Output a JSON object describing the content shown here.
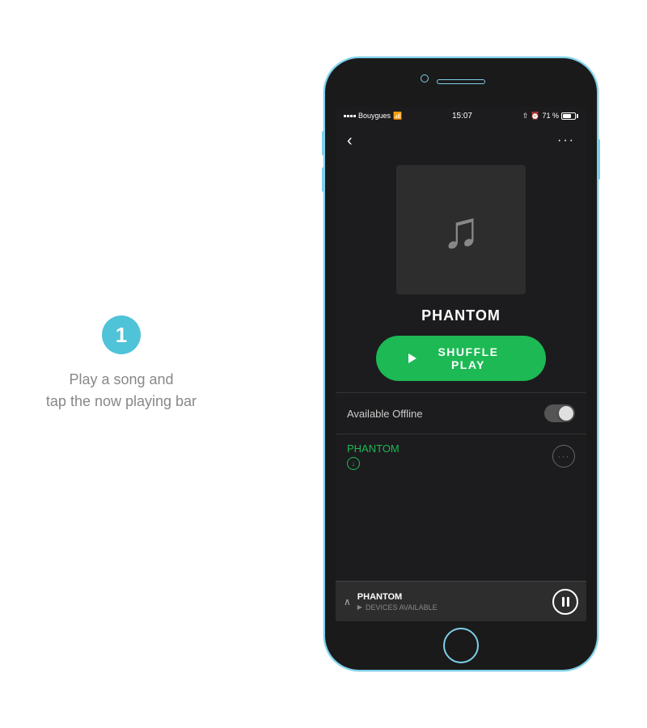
{
  "step": {
    "number": "1",
    "instruction_line1": "Play a song and",
    "instruction_line2": "tap the now playing bar"
  },
  "phone": {
    "status_bar": {
      "carrier": "Bouygues",
      "wifi_icon": "wifi",
      "time": "15:07",
      "location_icon": "arrow",
      "alarm_icon": "clock",
      "battery_percent": "71 %"
    },
    "nav": {
      "back_label": "‹",
      "more_label": "···"
    },
    "album": {
      "title": "PHANTOM",
      "art_icon": "music-note"
    },
    "shuffle_play_button": "SHUFFLE PLAY",
    "offline": {
      "label": "Available Offline"
    },
    "track": {
      "name": "PHANTOM",
      "more_icon": "···"
    },
    "now_playing": {
      "title": "PHANTOM",
      "sub_text": "DEVICES AVAILABLE"
    }
  },
  "colors": {
    "green": "#1db954",
    "phone_border": "#7ecfea",
    "bg_dark": "#1c1c1e",
    "step_badge": "#4fc3d8",
    "text_gray": "#888888"
  }
}
